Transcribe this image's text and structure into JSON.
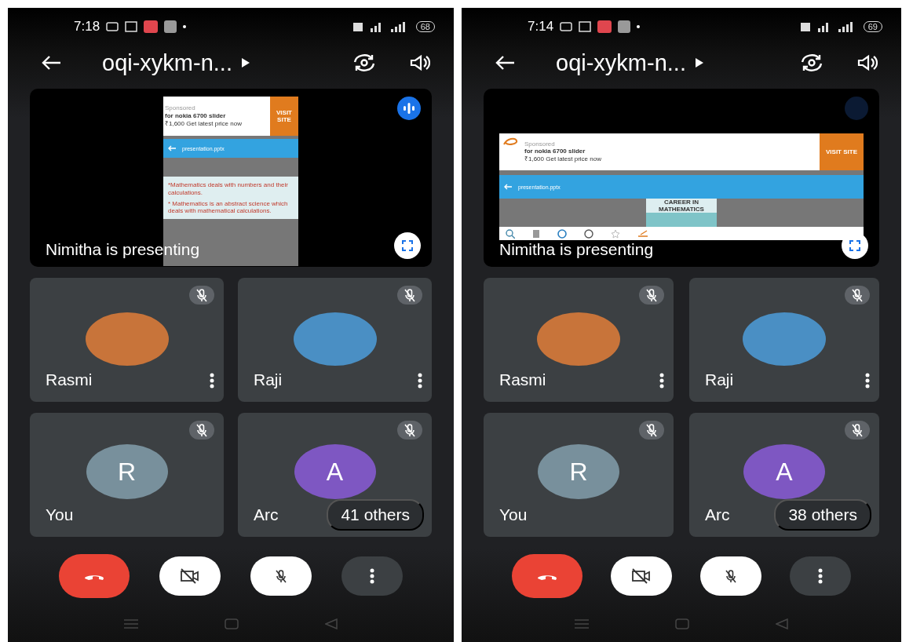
{
  "phones": [
    {
      "status_bar": {
        "time": "7:18",
        "battery": "68"
      },
      "header": {
        "title": "oqi-xykm-n..."
      },
      "presentation": {
        "speaking": true,
        "caption": "Nimitha is presenting",
        "share": {
          "kind": "portrait",
          "ad": {
            "label": "Sponsored",
            "title": "for nokia 6700 slider",
            "price": "₹1,600 Get latest price now",
            "button": "VISIT SITE"
          },
          "file": "presentation.pptx",
          "slide_lines": [
            "*Mathematics deals with numbers and their calculations.",
            "* Mathematics is an abstract science which deals with mathematical calculations."
          ]
        }
      },
      "tiles": [
        {
          "kind": "photo",
          "name": "Rasmi",
          "color": "#c8743a",
          "menu": true
        },
        {
          "kind": "photo",
          "name": "Raji",
          "color": "#4a8fc4",
          "menu": true
        },
        {
          "kind": "initial",
          "name": "You",
          "initial": "R",
          "color": "#78909c",
          "menu": false
        },
        {
          "kind": "initial",
          "name": "Arc",
          "initial": "A",
          "color": "#7e57c2",
          "menu": false,
          "others": "41 others"
        }
      ]
    },
    {
      "status_bar": {
        "time": "7:14",
        "battery": "69"
      },
      "header": {
        "title": "oqi-xykm-n..."
      },
      "presentation": {
        "speaking": false,
        "caption": "Nimitha is presenting",
        "share": {
          "kind": "landscape",
          "ad": {
            "label": "Sponsored",
            "title": "for nokia 6700 slider",
            "price": "₹1,600 Get latest price now",
            "button": "VISIT SITE"
          },
          "file": "presentation.pptx",
          "slide_title": "CAREER IN MATHEMATICS"
        }
      },
      "tiles": [
        {
          "kind": "photo",
          "name": "Rasmi",
          "color": "#c8743a",
          "menu": true
        },
        {
          "kind": "photo",
          "name": "Raji",
          "color": "#4a8fc4",
          "menu": true
        },
        {
          "kind": "initial",
          "name": "You",
          "initial": "R",
          "color": "#78909c",
          "menu": false
        },
        {
          "kind": "initial",
          "name": "Arc",
          "initial": "A",
          "color": "#7e57c2",
          "menu": false,
          "others": "38 others"
        }
      ]
    }
  ]
}
